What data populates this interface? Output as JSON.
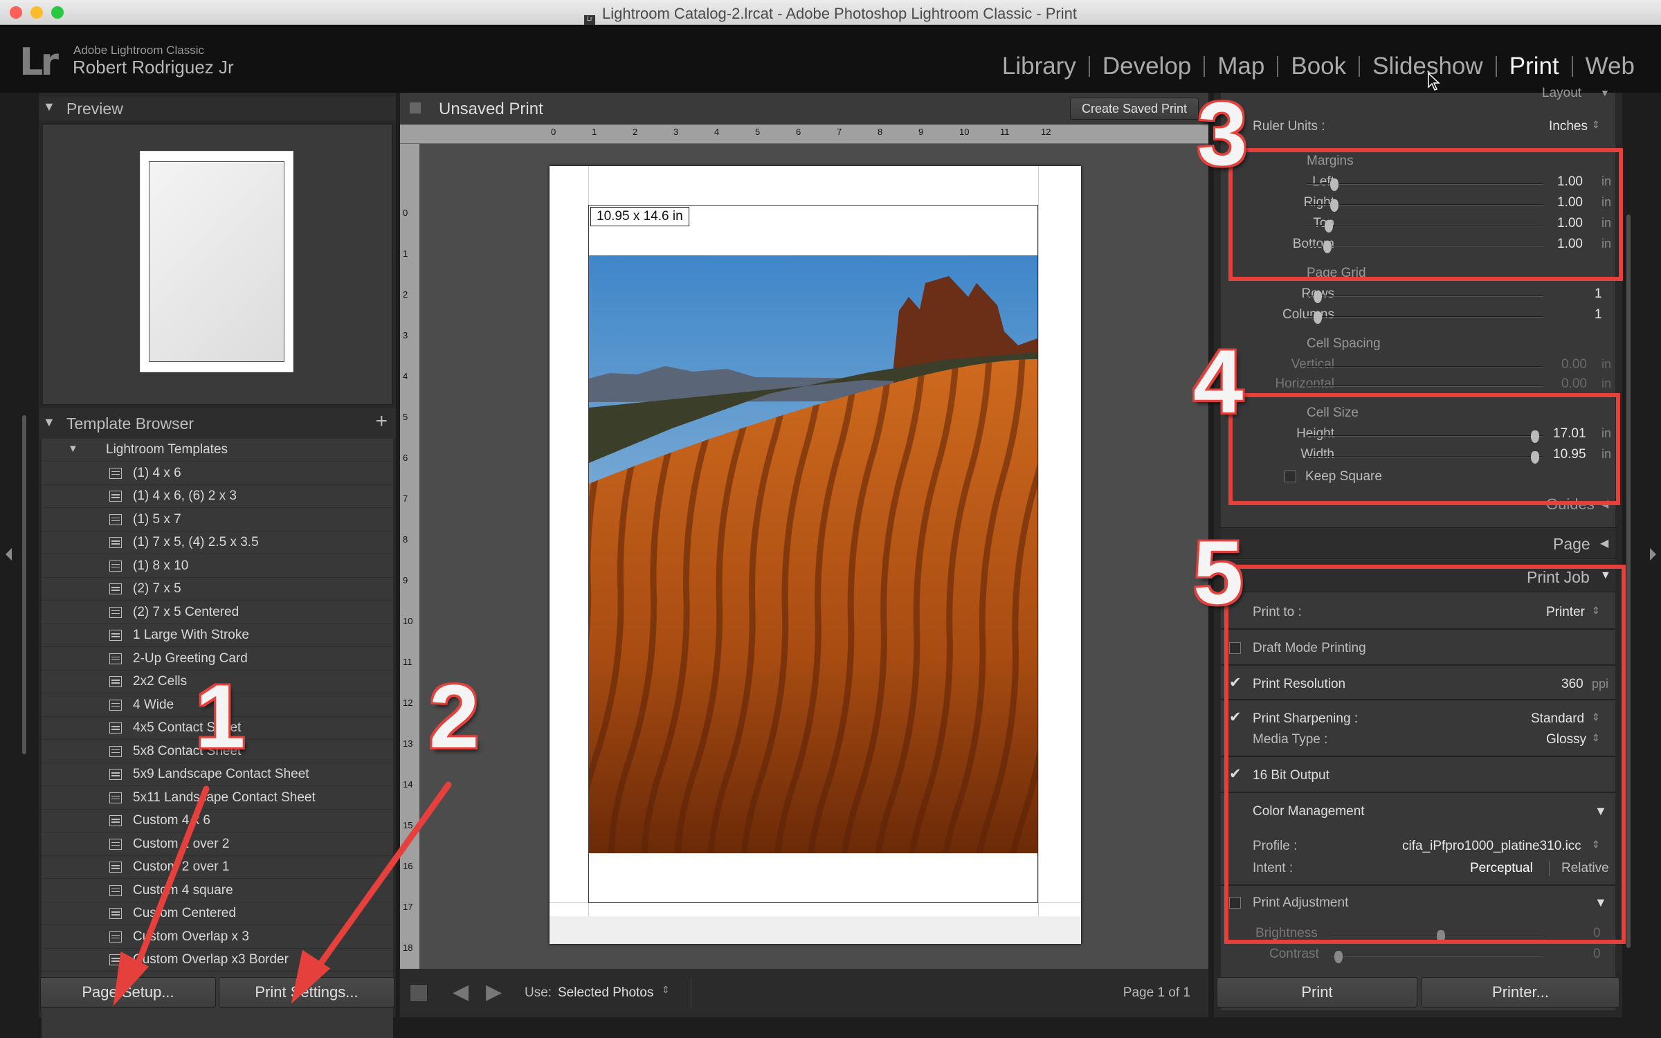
{
  "window": {
    "title": "Lightroom Catalog-2.lrcat - Adobe Photoshop Lightroom Classic - Print",
    "colors": {
      "close": "#fc5f57",
      "minimize": "#fdbc2e",
      "maximize": "#28c840"
    }
  },
  "identity": {
    "logo": "Lr",
    "app_name": "Adobe Lightroom Classic",
    "user": "Robert Rodriguez Jr"
  },
  "modules": [
    "Library",
    "Develop",
    "Map",
    "Book",
    "Slideshow",
    "Print",
    "Web"
  ],
  "active_module": "Print",
  "left_panel": {
    "preview_title": "Preview",
    "template_browser_title": "Template Browser",
    "add_icon": "+",
    "folder": "Lightroom Templates",
    "templates": [
      "(1) 4 x 6",
      "(1) 4 x 6, (6) 2 x 3",
      "(1) 5 x 7",
      "(1) 7 x 5, (4) 2.5 x 3.5",
      "(1) 8 x 10",
      "(2) 7 x 5",
      "(2) 7 x 5 Centered",
      "1 Large With Stroke",
      "2-Up Greeting Card",
      "2x2 Cells",
      "4 Wide",
      "4x5 Contact Sheet",
      "5x8 Contact Sheet",
      "5x9 Landscape Contact Sheet",
      "5x11 Landscape Contact Sheet",
      "Custom 4 x 6",
      "Custom 1 over 2",
      "Custom 2 over 1",
      "Custom 4 square",
      "Custom Centered",
      "Custom Overlap x 3",
      "Custom Overlap x3 Border"
    ],
    "page_setup_button": "Page Setup...",
    "print_settings_button": "Print Settings..."
  },
  "center": {
    "title": "Unsaved Print",
    "create_saved_button": "Create Saved Print",
    "ruler_h": [
      "0",
      "1",
      "2",
      "3",
      "4",
      "5",
      "6",
      "7",
      "8",
      "9",
      "10",
      "11",
      "12"
    ],
    "ruler_v": [
      "0",
      "1",
      "2",
      "3",
      "4",
      "5",
      "6",
      "7",
      "8",
      "9",
      "10",
      "11",
      "12",
      "13",
      "14",
      "15",
      "16",
      "17",
      "18"
    ],
    "size_badge": "10.95 x 14.6 in",
    "use_label": "Use:",
    "use_value": "Selected Photos",
    "page_indicator": "Page 1 of 1"
  },
  "right_panel": {
    "layout_title": "Layout",
    "ruler_units_label": "Ruler Units :",
    "ruler_units_value": "Inches",
    "margins_title": "Margins",
    "margins": [
      {
        "label": "Left",
        "value": "1.00",
        "unit": "in"
      },
      {
        "label": "Right",
        "value": "1.00",
        "unit": "in"
      },
      {
        "label": "Top",
        "value": "1.00",
        "unit": "in"
      },
      {
        "label": "Bottom",
        "value": "1.00",
        "unit": "in"
      }
    ],
    "page_grid_title": "Page Grid",
    "page_grid": [
      {
        "label": "Rows",
        "value": "1"
      },
      {
        "label": "Columns",
        "value": "1"
      }
    ],
    "cell_spacing_title": "Cell Spacing",
    "cell_spacing": [
      {
        "label": "Vertical",
        "value": "0.00",
        "unit": "in"
      },
      {
        "label": "Horizontal",
        "value": "0.00",
        "unit": "in"
      }
    ],
    "cell_size_title": "Cell Size",
    "cell_size": [
      {
        "label": "Height",
        "value": "17.01",
        "unit": "in"
      },
      {
        "label": "Width",
        "value": "10.95",
        "unit": "in"
      }
    ],
    "keep_square": "Keep Square",
    "guides_title": "Guides",
    "page_title": "Page",
    "print_job_title": "Print Job",
    "print_to_label": "Print to :",
    "print_to_value": "Printer",
    "draft_mode": "Draft Mode Printing",
    "print_resolution": "Print Resolution",
    "resolution_value": "360",
    "resolution_unit": "ppi",
    "print_sharpening": "Print Sharpening :",
    "sharpening_value": "Standard",
    "media_type_label": "Media Type :",
    "media_type_value": "Glossy",
    "bit_output": "16 Bit Output",
    "color_management": "Color Management",
    "profile_label": "Profile :",
    "profile_value": "cifa_iPfpro1000_platine310.icc",
    "intent_label": "Intent :",
    "intent_perceptual": "Perceptual",
    "intent_relative": "Relative",
    "print_adjustment": "Print Adjustment",
    "brightness_label": "Brightness",
    "brightness_value": "0",
    "contrast_label": "Contrast",
    "contrast_value": "0",
    "print_button": "Print",
    "printer_button": "Printer..."
  },
  "annotations": {
    "n1": "1",
    "n2": "2",
    "n3": "3",
    "n4": "4",
    "n5": "5",
    "accent": "#e6403d"
  }
}
